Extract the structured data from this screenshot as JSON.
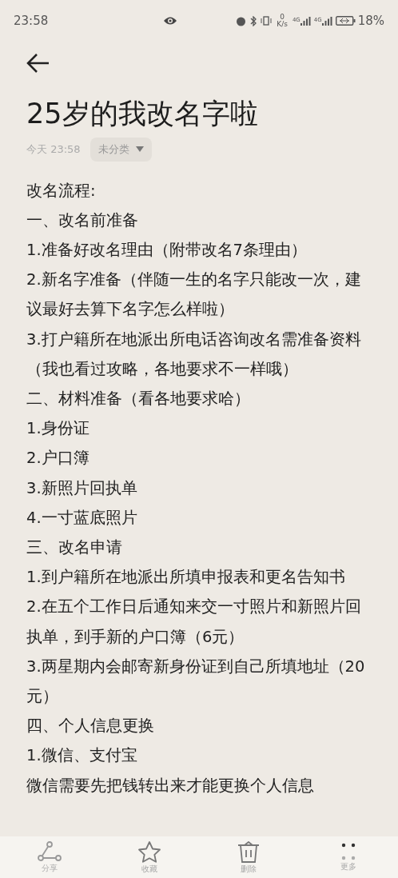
{
  "status_bar": {
    "time": "23:58",
    "net_speed_value": "0",
    "net_speed_unit": "K/s",
    "signal_1_label": "4G",
    "signal_2_label": "4G",
    "battery": "18%"
  },
  "note": {
    "title": "25岁的我改名字啦",
    "date": "今天 23:58",
    "category": "未分类",
    "lines": [
      "改名流程:",
      "一、改名前准备",
      "1.准备好改名理由（附带改名7条理由）",
      "2.新名字准备（伴随一生的名字只能改一次，建议最好去算下名字怎么样啦）",
      "3.打户籍所在地派出所电话咨询改名需准备资料（我也看过攻略，各地要求不一样哦）",
      "二、材料准备（看各地要求哈）",
      "1.身份证",
      "2.户口簿",
      "3.新照片回执单",
      "4.一寸蓝底照片",
      "三、改名申请",
      "1.到户籍所在地派出所填申报表和更名告知书",
      "2.在五个工作日后通知来交一寸照片和新照片回执单，到手新的户口簿（6元）",
      "3.两星期内会邮寄新身份证到自己所填地址（20元）",
      "四、个人信息更换",
      "1.微信、支付宝",
      "微信需要先把钱转出来才能更换个人信息"
    ]
  },
  "toolbar": [
    {
      "kind": "share",
      "label": "分享"
    },
    {
      "kind": "favorite",
      "label": "收藏"
    },
    {
      "kind": "delete",
      "label": "删除"
    },
    {
      "kind": "more",
      "label": "更多"
    }
  ]
}
